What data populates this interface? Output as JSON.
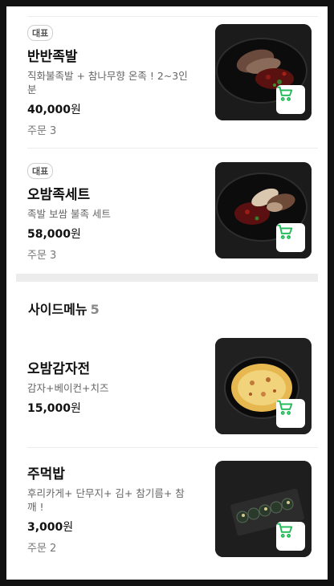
{
  "menu_items": [
    {
      "badge": "대표",
      "name": "반반족발",
      "description": "직화불족발 + 참나무향 온족 ! 2~3인분",
      "price": "40,000",
      "currency": "원",
      "orders": "주문 3"
    },
    {
      "badge": "대표",
      "name": "오밤족세트",
      "description": "족발 보쌈 불족 세트",
      "price": "58,000",
      "currency": "원",
      "orders": "주문 3"
    },
    {
      "name": "오밤감자전",
      "description": "감자+베이컨+치즈",
      "price": "15,000",
      "currency": "원"
    },
    {
      "name": "주먹밥",
      "description": "후리카게+ 단무지+ 김+ 참기름+ 참깨 !",
      "price": "3,000",
      "currency": "원",
      "orders": "주문 2"
    }
  ],
  "side_section": {
    "title": "사이드메뉴",
    "count": "5"
  },
  "colors": {
    "cart_accent": "#1db954",
    "image_background": "#1c1c1c"
  },
  "icons": {
    "cart": "shopping-cart-icon"
  }
}
